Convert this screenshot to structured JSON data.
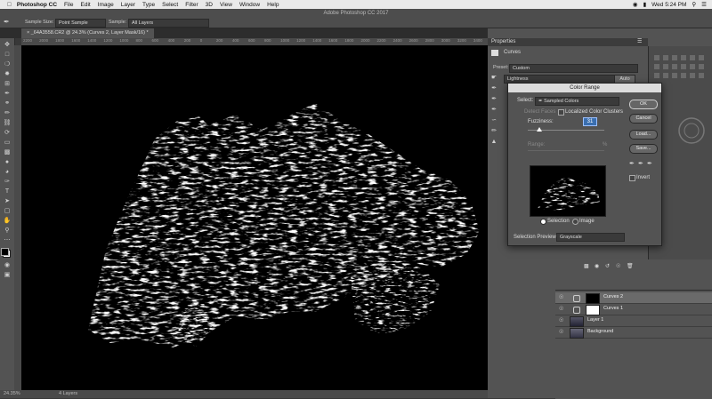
{
  "menubar": {
    "app_name": "Photoshop CC",
    "items": [
      "File",
      "Edit",
      "Image",
      "Layer",
      "Type",
      "Select",
      "Filter",
      "3D",
      "View",
      "Window",
      "Help"
    ],
    "clock": "Wed 5:24 PM"
  },
  "optionsbar": {
    "window_title": "Adobe Photoshop CC 2017",
    "sample_size_label": "Sample Size:",
    "sample_size_value": "Point Sample",
    "sample_label": "Sample:",
    "sample_value": "All Layers"
  },
  "document": {
    "tab_title": "_64A3558.CR2 @ 24.3% (Curves 2, Layer Mask/16) *",
    "ruler_ticks": [
      "2200",
      "2000",
      "1800",
      "1600",
      "1400",
      "1200",
      "1000",
      "800",
      "600",
      "400",
      "200",
      "0",
      "200",
      "400",
      "600",
      "800",
      "1000",
      "1200",
      "1400",
      "1600",
      "1800",
      "2000",
      "2200",
      "2400",
      "2600",
      "2800",
      "3000",
      "3200",
      "3400"
    ],
    "status_zoom": "24.35%",
    "status_layers": "4 Layers"
  },
  "properties": {
    "panel_title": "Properties",
    "adjustment_name": "Curves",
    "preset_label": "Preset:",
    "preset_value": "Custom",
    "channel_value": "Lightness",
    "auto_label": "Auto"
  },
  "color_range": {
    "title": "Color Range",
    "select_label": "Select:",
    "select_value": "Sampled Colors",
    "detect_faces_label": "Detect Faces",
    "localized_label": "Localized Color Clusters",
    "fuzziness_label": "Fuzziness:",
    "fuzziness_value": "31",
    "fuzziness_fraction": 0.155,
    "range_label": "Range:",
    "range_unit": "%",
    "radio_selection": "Selection",
    "radio_image": "Image",
    "preview_label": "Selection Preview:",
    "preview_value": "Grayscale",
    "buttons": {
      "ok": "OK",
      "cancel": "Cancel",
      "load": "Load...",
      "save": "Save..."
    },
    "invert_label": "Invert"
  },
  "layers": {
    "items": [
      {
        "name": "Curves 2",
        "active": true
      },
      {
        "name": "Curves 1",
        "active": false
      },
      {
        "name": "Layer 1",
        "active": false
      },
      {
        "name": "Background",
        "active": false
      }
    ]
  }
}
